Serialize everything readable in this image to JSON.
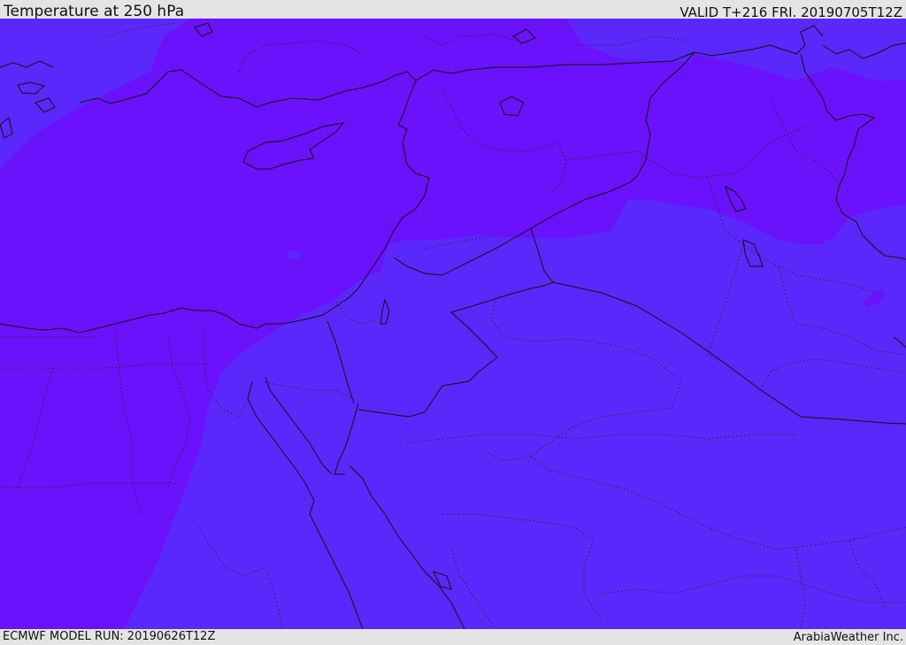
{
  "header": {
    "title": "Temperature at 250 hPa",
    "valid": "VALID T+216 FRI. 20190705T12Z"
  },
  "footer": {
    "model_run": "ECMWF MODEL RUN: 20190626T12Z",
    "credit": "ArabiaWeather Inc."
  },
  "map": {
    "colors": {
      "warm_band": "#6a12fb",
      "cool_band": "#5a28fb",
      "outline": "#111111"
    }
  }
}
